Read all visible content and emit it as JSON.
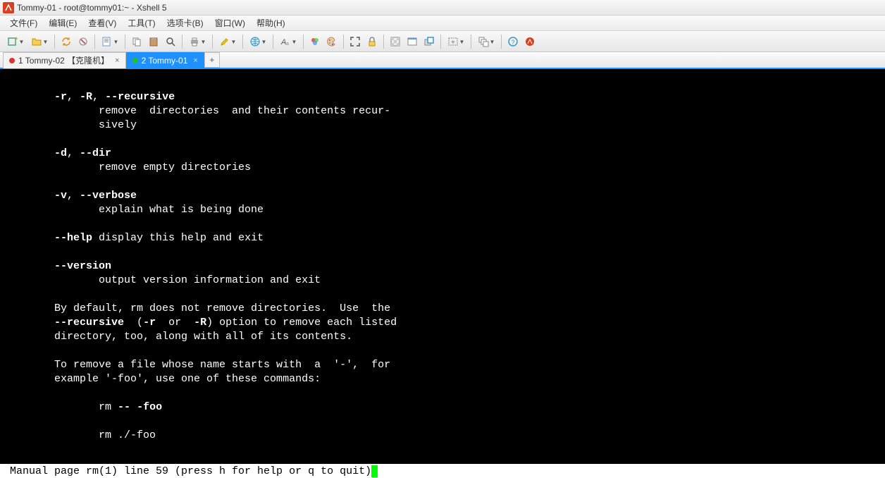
{
  "titlebar": {
    "text": "Tommy-01 - root@tommy01:~ - Xshell 5"
  },
  "menubar": {
    "items": [
      "文件(F)",
      "编辑(E)",
      "查看(V)",
      "工具(T)",
      "选项卡(B)",
      "窗口(W)",
      "帮助(H)"
    ]
  },
  "tabs": [
    {
      "label": "1 Tommy-02 【克隆机】",
      "dot_color": "#e03030",
      "active": false
    },
    {
      "label": "2 Tommy-01",
      "dot_color": "#20c030",
      "active": true
    }
  ],
  "terminal": {
    "lines": [
      {
        "indent": 7,
        "parts": [
          {
            "t": "-r",
            "b": true
          },
          {
            "t": ", "
          },
          {
            "t": "-R",
            "b": true
          },
          {
            "t": ", "
          },
          {
            "t": "--recursive",
            "b": true
          }
        ]
      },
      {
        "indent": 14,
        "parts": [
          {
            "t": "remove  directories  and their contents recur‐"
          }
        ]
      },
      {
        "indent": 14,
        "parts": [
          {
            "t": "sively"
          }
        ]
      },
      {
        "indent": 0,
        "parts": [
          {
            "t": ""
          }
        ]
      },
      {
        "indent": 7,
        "parts": [
          {
            "t": "-d",
            "b": true
          },
          {
            "t": ", "
          },
          {
            "t": "--dir",
            "b": true
          }
        ]
      },
      {
        "indent": 14,
        "parts": [
          {
            "t": "remove empty directories"
          }
        ]
      },
      {
        "indent": 0,
        "parts": [
          {
            "t": ""
          }
        ]
      },
      {
        "indent": 7,
        "parts": [
          {
            "t": "-v",
            "b": true
          },
          {
            "t": ", "
          },
          {
            "t": "--verbose",
            "b": true
          }
        ]
      },
      {
        "indent": 14,
        "parts": [
          {
            "t": "explain what is being done"
          }
        ]
      },
      {
        "indent": 0,
        "parts": [
          {
            "t": ""
          }
        ]
      },
      {
        "indent": 7,
        "parts": [
          {
            "t": "--help",
            "b": true
          },
          {
            "t": " display this help and exit"
          }
        ]
      },
      {
        "indent": 0,
        "parts": [
          {
            "t": ""
          }
        ]
      },
      {
        "indent": 7,
        "parts": [
          {
            "t": "--version",
            "b": true
          }
        ]
      },
      {
        "indent": 14,
        "parts": [
          {
            "t": "output version information and exit"
          }
        ]
      },
      {
        "indent": 0,
        "parts": [
          {
            "t": ""
          }
        ]
      },
      {
        "indent": 7,
        "parts": [
          {
            "t": "By default, rm does not remove directories.  Use  the"
          }
        ]
      },
      {
        "indent": 7,
        "parts": [
          {
            "t": "--recursive",
            "b": true
          },
          {
            "t": "  ("
          },
          {
            "t": "-r",
            "b": true
          },
          {
            "t": "  or  "
          },
          {
            "t": "-R",
            "b": true
          },
          {
            "t": ") option to remove each listed"
          }
        ]
      },
      {
        "indent": 7,
        "parts": [
          {
            "t": "directory, too, along with all of its contents."
          }
        ]
      },
      {
        "indent": 0,
        "parts": [
          {
            "t": ""
          }
        ]
      },
      {
        "indent": 7,
        "parts": [
          {
            "t": "To remove a file whose name starts with  a  '-',  for"
          }
        ]
      },
      {
        "indent": 7,
        "parts": [
          {
            "t": "example '-foo', use one of these commands:"
          }
        ]
      },
      {
        "indent": 0,
        "parts": [
          {
            "t": ""
          }
        ]
      },
      {
        "indent": 14,
        "parts": [
          {
            "t": "rm "
          },
          {
            "t": "--",
            "b": true
          },
          {
            "t": " "
          },
          {
            "t": "-foo",
            "b": true
          }
        ]
      },
      {
        "indent": 0,
        "parts": [
          {
            "t": ""
          }
        ]
      },
      {
        "indent": 14,
        "parts": [
          {
            "t": "rm ./-foo"
          }
        ]
      }
    ]
  },
  "statusline": {
    "text": " Manual page rm(1) line 59 (press h for help or q to quit)"
  },
  "toolbar_icons": [
    "new-session",
    "open",
    "sep",
    "reconnect",
    "disconnect",
    "sep",
    "properties",
    "sep",
    "copy",
    "paste",
    "search",
    "sep",
    "print",
    "sep",
    "highlight",
    "sep",
    "web",
    "sep",
    "font",
    "sep",
    "colors",
    "palette",
    "sep",
    "fullscreen",
    "lock",
    "sep",
    "transparent",
    "simple",
    "always-top",
    "sep",
    "add",
    "sep",
    "cascade",
    "sep",
    "help",
    "about"
  ]
}
